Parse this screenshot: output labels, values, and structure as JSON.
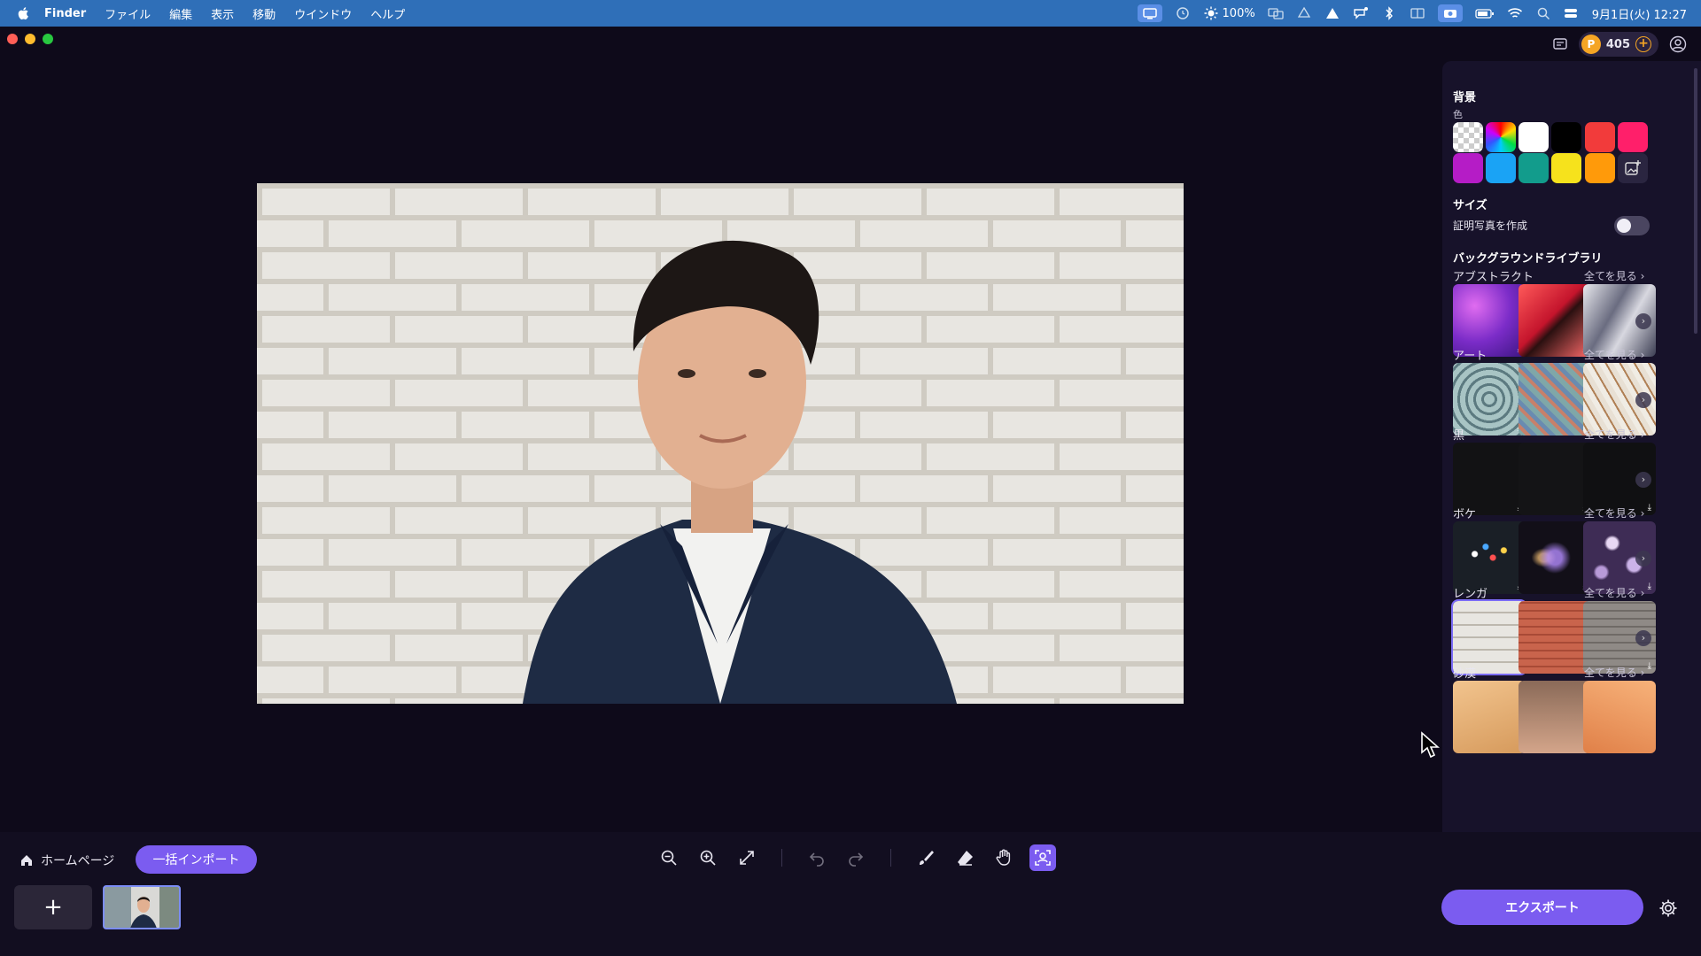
{
  "menubar": {
    "app": "Finder",
    "items": [
      "ファイル",
      "編集",
      "表示",
      "移動",
      "ウインドウ",
      "ヘルプ"
    ],
    "brightness": "100%",
    "datetime": "9月1日(火)  12:27"
  },
  "header": {
    "credits": "405"
  },
  "panel": {
    "background_title": "背景",
    "color_label": "色",
    "colors": [
      "checker",
      "rainbow",
      "#ffffff",
      "#000000",
      "#f23b3b",
      "#ff1f6a",
      "#b51cc6",
      "#1aa3f5",
      "#129c8c",
      "#f6e21c",
      "#ff9a0a",
      "add-image"
    ],
    "size_title": "サイズ",
    "id_photo_label": "証明写真を作成",
    "id_photo_enabled": false,
    "library_title": "バックグラウンドライブラリ",
    "see_all": "全てを見る",
    "categories": [
      {
        "name": "アブストラクト"
      },
      {
        "name": "アート"
      },
      {
        "name": "黒"
      },
      {
        "name": "ボケ"
      },
      {
        "name": "レンガ"
      },
      {
        "name": "砂漠"
      }
    ]
  },
  "toolbar": {
    "home_label": "ホームページ",
    "batch_import_label": "一括インポート",
    "add_label": "+",
    "export_label": "エクスポート"
  },
  "colors": {
    "accent": "#7b5cf0",
    "menubar": "#2f6fb8",
    "canvas_bg": "#0e0a1a"
  }
}
